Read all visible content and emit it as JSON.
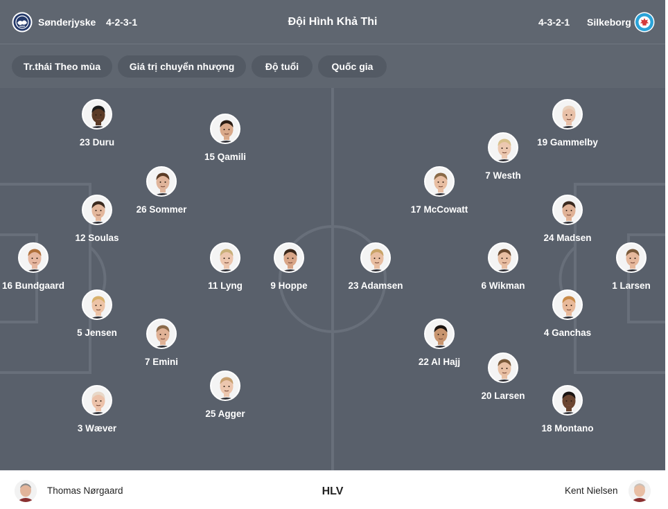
{
  "header": {
    "title": "Đội Hình Khả Thi",
    "home": {
      "name": "Sønderjyske",
      "formation": "4-2-3-1",
      "logo_icon": "sonderjyske-crest-icon",
      "color": "#2a3f6e"
    },
    "away": {
      "name": "Silkeborg",
      "formation": "4-3-2-1",
      "logo_icon": "silkeborg-crest-icon",
      "color": "#2aa3d8"
    }
  },
  "tabs": [
    {
      "label": "Tr.thái Theo mùa"
    },
    {
      "label": "Giá trị chuyển nhượng"
    },
    {
      "label": "Độ tuổi"
    },
    {
      "label": "Quốc gia"
    }
  ],
  "home_players": [
    {
      "label": "23 Duru",
      "skin": "#5a3a26",
      "hair": "#1a1a1a"
    },
    {
      "label": "15 Qamili",
      "skin": "#d9a98a",
      "hair": "#2b1d14"
    },
    {
      "label": "26 Sommer",
      "skin": "#e0b49a",
      "hair": "#5a3b25"
    },
    {
      "label": "12 Soulas",
      "skin": "#e3b79c",
      "hair": "#3b2a1f"
    },
    {
      "label": "16 Bundgaard",
      "skin": "#e6b7a0",
      "hair": "#b0703b"
    },
    {
      "label": "11 Lyng",
      "skin": "#ecc6ae",
      "hair": "#c9b07a"
    },
    {
      "label": "9 Hoppe",
      "skin": "#d8a587",
      "hair": "#3a271a"
    },
    {
      "label": "5 Jensen",
      "skin": "#edc3a6",
      "hair": "#d8b06b"
    },
    {
      "label": "7 Emini",
      "skin": "#e0b296",
      "hair": "#8a6a4a"
    },
    {
      "label": "25 Agger",
      "skin": "#ecc6ae",
      "hair": "#c8a070"
    },
    {
      "label": "3 Wæver",
      "skin": "#ecc2aa",
      "hair": "#e8d8c8"
    }
  ],
  "away_players": [
    {
      "label": "19 Gammelby",
      "skin": "#e8c0a8",
      "hair": "#e8d0bc"
    },
    {
      "label": "7 Westh",
      "skin": "#ecc8b0",
      "hair": "#d8c08a"
    },
    {
      "label": "17 McCowatt",
      "skin": "#e8bea2",
      "hair": "#8a6a48"
    },
    {
      "label": "24 Madsen",
      "skin": "#e0b296",
      "hair": "#3b2a1f"
    },
    {
      "label": "23 Adamsen",
      "skin": "#e8bea2",
      "hair": "#c9a468"
    },
    {
      "label": "6 Wikman",
      "skin": "#e8bea2",
      "hair": "#6a4a30"
    },
    {
      "label": "1 Larsen",
      "skin": "#e6b89c",
      "hair": "#7a5a3a"
    },
    {
      "label": "4 Ganchas",
      "skin": "#e8b99a",
      "hair": "#c88a48"
    },
    {
      "label": "22 Al Hajj",
      "skin": "#c8956f",
      "hair": "#1a1410"
    },
    {
      "label": "20 Larsen",
      "skin": "#e8c0a4",
      "hair": "#7a5a3a"
    },
    {
      "label": "18 Montano",
      "skin": "#6a4530",
      "hair": "#1a1412"
    }
  ],
  "coaches": {
    "label": "HLV",
    "home": {
      "name": "Thomas Nørgaard"
    },
    "away": {
      "name": "Kent Nielsen"
    }
  }
}
